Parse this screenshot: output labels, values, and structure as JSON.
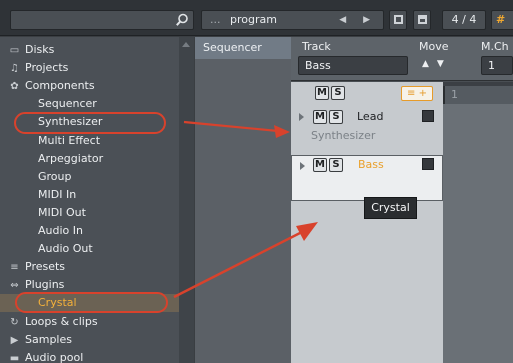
{
  "topbar": {
    "program_prefix": "...",
    "program_label": "program",
    "program_arrows": "◀ ▶",
    "page_indicator": "4 / 4",
    "hash_label": "#"
  },
  "sidebar": {
    "items": [
      {
        "label": "Disks",
        "icon": "disk-icon",
        "glyph": "▭"
      },
      {
        "label": "Projects",
        "icon": "music-note-icon",
        "glyph": "♫"
      },
      {
        "label": "Components",
        "icon": "gear-icon",
        "glyph": "✿"
      },
      {
        "label": "Sequencer"
      },
      {
        "label": "Synthesizer"
      },
      {
        "label": "Multi Effect"
      },
      {
        "label": "Arpeggiator"
      },
      {
        "label": "Group"
      },
      {
        "label": "MIDI In"
      },
      {
        "label": "MIDI Out"
      },
      {
        "label": "Audio In"
      },
      {
        "label": "Audio Out"
      },
      {
        "label": "Presets",
        "icon": "list-icon",
        "glyph": "≡"
      },
      {
        "label": "Plugins",
        "icon": "plug-icon",
        "glyph": "⇔"
      },
      {
        "label": "Crystal"
      },
      {
        "label": "Loops & clips",
        "icon": "loop-icon",
        "glyph": "↻"
      },
      {
        "label": "Samples",
        "icon": "play-icon",
        "glyph": "▶"
      },
      {
        "label": "Audio pool",
        "icon": "folder-icon",
        "glyph": "▬"
      }
    ]
  },
  "sequencer": {
    "header": "Sequencer"
  },
  "track_header": {
    "track_label": "Track",
    "track_value": "Bass",
    "move_label": "Move",
    "move_arrows": "▲▼",
    "mch_label": "M.Ch",
    "mch_value": "1"
  },
  "tools": {
    "mute": "M",
    "solo": "S",
    "add": "≡ +"
  },
  "tracks": [
    {
      "name": "Lead",
      "sub": "Synthesizer",
      "mute": "M",
      "solo": "S"
    },
    {
      "name": "Bass",
      "sub": "",
      "mute": "M",
      "solo": "S"
    }
  ],
  "lane": {
    "marker": "1"
  },
  "tooltip": {
    "text": "Crystal"
  },
  "colors": {
    "accent": "#f4b13a",
    "annotation": "#d8422c"
  }
}
